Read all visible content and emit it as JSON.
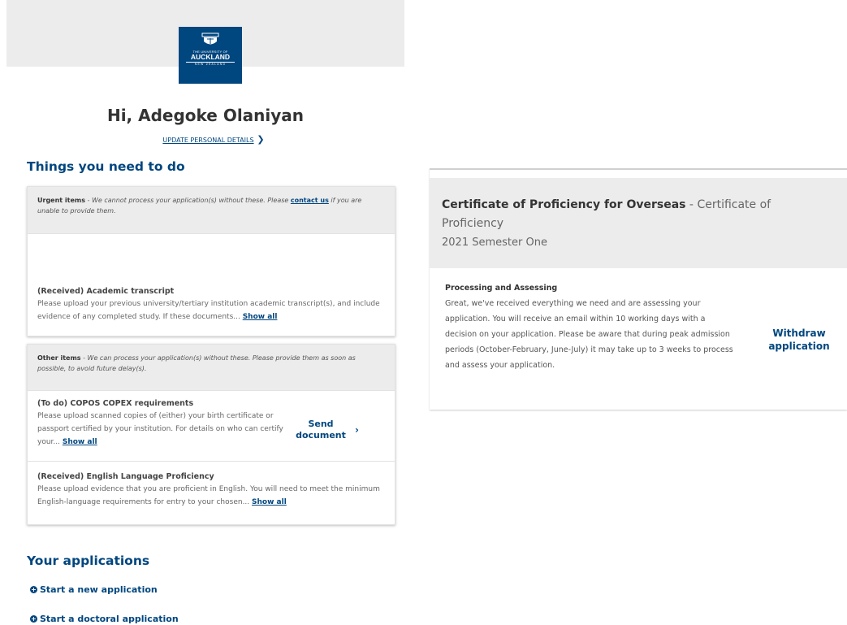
{
  "header": {
    "logo": {
      "line1": "THE UNIVERSITY OF",
      "line2": "AUCKLAND",
      "line3": "NEW ZEALAND",
      "color": "#00467f"
    }
  },
  "greeting": "Hi, Adegoke Olaniyan",
  "update_details": "UPDATE PERSONAL DETAILS",
  "todo": {
    "title": "Things you need to do",
    "urgent": {
      "label": "Urgent items",
      "text": " - We cannot process your application(s) without these. Please ",
      "link": "contact us",
      "text_after": " if you are unable to provide them."
    },
    "urgent_items": [
      {
        "title": "(Received) Academic transcript",
        "desc": "Please upload your previous university/tertiary institution academic transcript(s), and include evidence of any completed study. If these documents... ",
        "show_all": "Show all"
      }
    ],
    "other": {
      "label": "Other items",
      "text": " - We can process your application(s) without these. Please provide them as soon as possible, to avoid future delay(s)."
    },
    "other_items": [
      {
        "title": "(To do) COPOS COPEX requirements",
        "desc": "Please upload scanned copies of (either) your birth certificate or passport certified by your institution. For details on who can certify your... ",
        "show_all": "Show all",
        "action": "Send document"
      },
      {
        "title": "(Received) English Language Proficiency",
        "desc": "Please upload evidence that you are proficient in English. You will need to meet the minimum English-language requirements for entry to your chosen... ",
        "show_all": "Show all"
      }
    ]
  },
  "applications": {
    "title": "Your applications",
    "links": [
      "Start a new application",
      "Start a doctoral application"
    ]
  },
  "application_card": {
    "course": "Certificate of Proficiency for Overseas",
    "separator": " - ",
    "course_type": "Certificate of Proficiency",
    "semester": "2021 Semester One",
    "status_title": "Processing and Assessing",
    "status_text": "Great, we've received everything we need and are assessing your application. You will receive an email within 10 working days with a decision on your application. Please be aware that during peak admission periods (October-February, June-July) it may take up to 3 weeks to process and assess your application.",
    "action": "Withdraw application"
  }
}
